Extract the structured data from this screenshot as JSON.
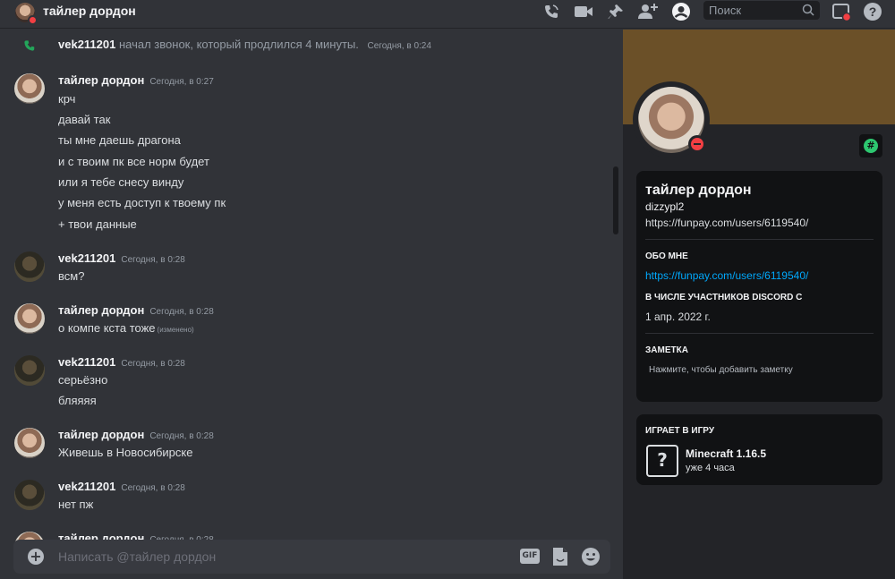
{
  "header": {
    "title": "тайлер дордон",
    "search_placeholder": "Поиск"
  },
  "call": {
    "user": "vek211201",
    "text": "начал звонок, который продлился 4 минуты.",
    "timestamp": "Сегодня, в 0:24"
  },
  "messages": [
    {
      "author": "тайлер дордон",
      "timestamp": "Сегодня, в 0:27",
      "lines": [
        "крч",
        "давай так",
        "ты мне даешь драгона",
        "и с твоим пк все  норм будет",
        "или я тебе снесу винду",
        "у меня есть доступ к твоему пк",
        "+ твои данные"
      ]
    },
    {
      "author": "vek211201",
      "timestamp": "Сегодня, в 0:28",
      "lines": [
        "всм?"
      ]
    },
    {
      "author": "тайлер дордон",
      "timestamp": "Сегодня, в 0:28",
      "lines": [
        "о компе кста тоже"
      ],
      "edited": "(изменено)"
    },
    {
      "author": "vek211201",
      "timestamp": "Сегодня, в 0:28",
      "lines": [
        "серьёзно",
        "бляяяя"
      ]
    },
    {
      "author": "тайлер дордон",
      "timestamp": "Сегодня, в 0:28",
      "lines": [
        "Живешь в  Новосибирске"
      ]
    },
    {
      "author": "vek211201",
      "timestamp": "Сегодня, в 0:28",
      "lines": [
        "нет пж"
      ]
    },
    {
      "author": "тайлер дордон",
      "timestamp": "Сегодня, в 0:28",
      "lines": []
    }
  ],
  "composer": {
    "placeholder": "Написать @тайлер дордон",
    "gif_label": "GIF"
  },
  "profile": {
    "display_name": "тайлер дордон",
    "username": "dizzypl2",
    "pronouns": "https://funpay.com/users/6119540/",
    "about_header": "ОБО МНЕ",
    "about_link": "https://funpay.com/users/6119540/",
    "member_header": "В ЧИСЛЕ УЧАСТНИКОВ DISCORD С",
    "member_since": "1 апр. 2022 г.",
    "note_header": "ЗАМЕТКА",
    "note_placeholder": "Нажмите, чтобы добавить заметку",
    "playing_header": "ИГРАЕТ В ИГРУ",
    "game_name": "Minecraft 1.16.5",
    "game_time": "уже 4 часа",
    "banner_color": "#6b5028",
    "status": "dnd"
  },
  "colors": {
    "accent_link": "#00a8fc",
    "dnd": "#f23f43",
    "online_badge": "#2dc770"
  }
}
